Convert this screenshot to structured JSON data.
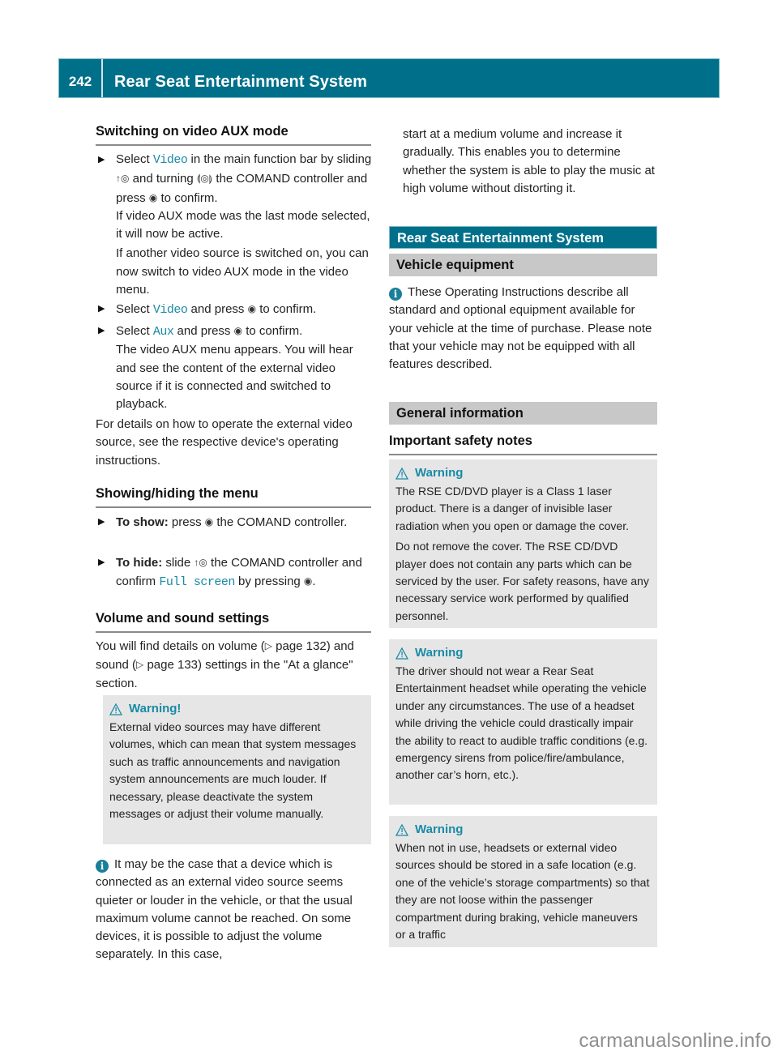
{
  "header": {
    "page_number": "242",
    "title": "Rear Seat Entertainment System"
  },
  "left": {
    "s1": {
      "heading": "Switching on video AUX mode",
      "b1": {
        "pre": "Select ",
        "hl": "Video",
        "mid1": " in the main function bar by sliding ",
        "icon_slide": "↑◎",
        "mid2": " and turning ",
        "icon_turn": "⟬◎⟭",
        "mid3": " the COMAND controller and press ",
        "icon_press": "◉",
        "post": " to confirm.",
        "p2": "If video AUX mode was the last mode selected, it will now be active.",
        "p3": "If another video source is switched on, you can now switch to video AUX mode in the video menu."
      },
      "b2": {
        "pre": "Select ",
        "hl": "Video",
        "mid": " and press ",
        "icon_press": "◉",
        "post": " to confirm."
      },
      "b3": {
        "pre": "Select ",
        "hl": "Aux",
        "mid": " and press ",
        "icon_press": "◉",
        "post": " to confirm.",
        "p2": "The video AUX menu appears. You will hear and see the content of the external video source if it is connected and switched to playback."
      },
      "para": "For details on how to operate the external video source, see the respective device's operating instructions."
    },
    "s2": {
      "heading": "Showing/hiding the menu",
      "b1": {
        "label": "To show:",
        "pre": " press ",
        "icon_press": "◉",
        "post": " the COMAND controller."
      },
      "b2": {
        "label": "To hide:",
        "pre": " slide ",
        "icon_slide": "↑◎",
        "mid": " the COMAND controller and confirm ",
        "hl": "Full screen",
        "mid2": " by pressing ",
        "icon_press": "◉",
        "post": "."
      }
    },
    "s3": {
      "heading": "Volume and sound settings",
      "para_a": "You will find details on volume (",
      "ref_icon": "▷",
      "ref1": " page 132)",
      "para_b": " and sound (",
      "ref2": " page 133) settings in the \"At a glance\" section."
    },
    "warning": {
      "title": "Warning!",
      "text": "External video sources may have different volumes, which can mean that system messages such as traffic announcements and navigation system announcements are much louder. If necessary, please deactivate the system messages or adjust their volume manually."
    },
    "note": {
      "text": "It may be the case that a device which is connected as an external video source seems quieter or louder in the vehicle, or that the usual maximum volume cannot be reached. On some devices, it is possible to adjust the volume separately. In this case,"
    }
  },
  "right": {
    "cont": "start at a medium volume and increase it gradually. This enables you to determine whether the system is able to play the music at high volume without distorting it.",
    "band_teal": "Rear Seat Entertainment System",
    "band_vehicle": "Vehicle equipment",
    "note": "These Operating Instructions describe all standard and optional equipment available for your vehicle at the time of purchase. Please note that your vehicle may not be equipped with all features described.",
    "band_general": "General information",
    "heading_safety": "Important safety notes",
    "warnings": [
      {
        "title": "Warning",
        "paras": [
          "The RSE CD/DVD player is a Class 1 laser product. There is a danger of invisible laser radiation when you open or damage the cover.",
          "Do not remove the cover. The RSE CD/DVD player does not contain any parts which can be serviced by the user. For safety reasons, have any necessary service work performed by qualified personnel."
        ]
      },
      {
        "title": "Warning",
        "paras": [
          "The driver should not wear a Rear Seat Entertainment headset while operating the vehicle under any circumstances. The use of a headset while driving the vehicle could drastically impair the ability to react to audible traffic conditions (e.g. emergency sirens from police/fire/ambulance, another car’s horn, etc.)."
        ]
      },
      {
        "title": "Warning",
        "paras": [
          "When not in use, headsets or external video sources should be stored in a safe location (e.g. one of the vehicle’s storage compartments) so that they are not loose within the passenger compartment during braking, vehicle maneuvers or a traffic"
        ]
      }
    ]
  },
  "watermark": "carmanualsonline.info",
  "colors": {
    "accent": "#00708a",
    "highlight": "#1a8aa6",
    "box_bg": "#e6e6e6",
    "band_grey": "#c8c8c8"
  }
}
